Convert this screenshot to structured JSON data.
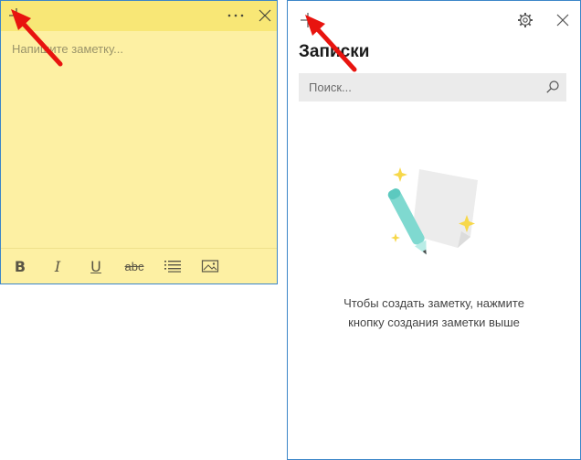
{
  "note": {
    "placeholder": "Напишите заметку...",
    "toolbar": {
      "bold": "B",
      "italic": "I",
      "underline": "U",
      "strikethrough": "abc"
    }
  },
  "notes_list": {
    "title": "Записки",
    "search": {
      "placeholder": "Поиск..."
    },
    "empty_state": {
      "line1": "Чтобы создать заметку, нажмите",
      "line2": "кнопку создания заметки выше"
    }
  },
  "icons": {
    "add": "plus-icon",
    "more": "more-icon",
    "close": "close-icon",
    "settings": "gear-icon",
    "search": "search-icon",
    "list": "bullet-list-icon",
    "image": "image-icon"
  },
  "colors": {
    "note_body": "#fdf0a3",
    "note_titlebar": "#f8e776",
    "window_border": "#3c86c8",
    "search_bg": "#ebebeb",
    "annotation_arrow": "#e8140f"
  }
}
